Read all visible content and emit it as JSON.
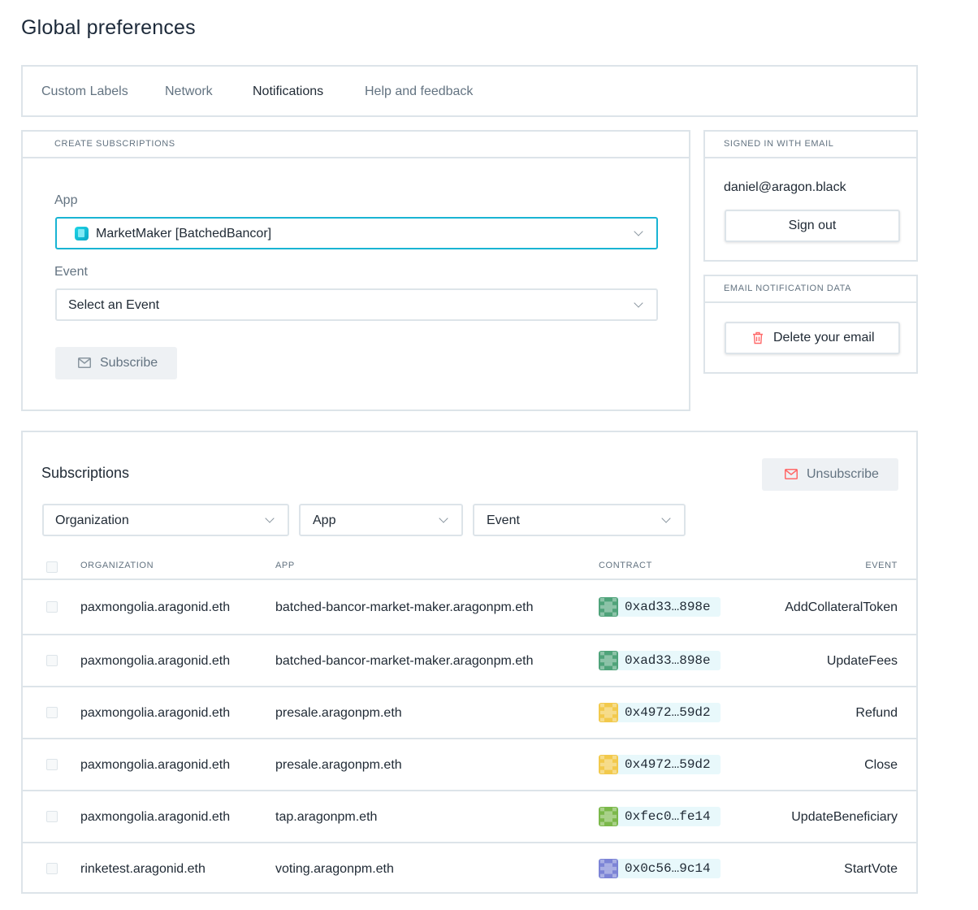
{
  "page_title": "Global preferences",
  "tabs": [
    {
      "label": "Custom Labels"
    },
    {
      "label": "Network"
    },
    {
      "label": "Notifications"
    },
    {
      "label": "Help and feedback"
    }
  ],
  "active_tab": "Notifications",
  "create": {
    "header": "CREATE SUBSCRIPTIONS",
    "app_label": "App",
    "app_value": "MarketMaker [BatchedBancor]",
    "event_label": "Event",
    "event_value": "Select an Event",
    "subscribe_label": "Subscribe"
  },
  "signed_in": {
    "header": "SIGNED IN WITH EMAIL",
    "email": "daniel@aragon.black",
    "sign_out_label": "Sign out"
  },
  "email_data": {
    "header": "EMAIL NOTIFICATION DATA",
    "delete_label": "Delete your email"
  },
  "subscriptions": {
    "title": "Subscriptions",
    "unsubscribe_label": "Unsubscribe",
    "filters": {
      "organization": "Organization",
      "app": "App",
      "event": "Event"
    },
    "columns": {
      "organization": "ORGANIZATION",
      "app": "APP",
      "contract": "CONTRACT",
      "event": "EVENT"
    },
    "rows": [
      {
        "organization": "paxmongolia.aragonid.eth",
        "app": "batched-bancor-market-maker.aragonpm.eth",
        "contract": "0xad33…898e",
        "event": "AddCollateralToken"
      },
      {
        "organization": "paxmongolia.aragonid.eth",
        "app": "batched-bancor-market-maker.aragonpm.eth",
        "contract": "0xad33…898e",
        "event": "UpdateFees"
      },
      {
        "organization": "paxmongolia.aragonid.eth",
        "app": "presale.aragonpm.eth",
        "contract": "0x4972…59d2",
        "event": "Refund"
      },
      {
        "organization": "paxmongolia.aragonid.eth",
        "app": "presale.aragonpm.eth",
        "contract": "0x4972…59d2",
        "event": "Close"
      },
      {
        "organization": "paxmongolia.aragonid.eth",
        "app": "tap.aragonpm.eth",
        "contract": "0xfec0…fe14",
        "event": "UpdateBeneficiary"
      },
      {
        "organization": "rinketest.aragonid.eth",
        "app": "voting.aragonpm.eth",
        "contract": "0x0c56…9c14",
        "event": "StartVote"
      }
    ]
  },
  "colors": {
    "accent": "#19b4d3",
    "border": "#dde4e9",
    "danger": "#ff6969",
    "muted_text": "#637381",
    "identicons": [
      "#4fa37a",
      "#4fa37a",
      "#f2c94c",
      "#f2c94c",
      "#7bb84a",
      "#7c84d6"
    ]
  }
}
